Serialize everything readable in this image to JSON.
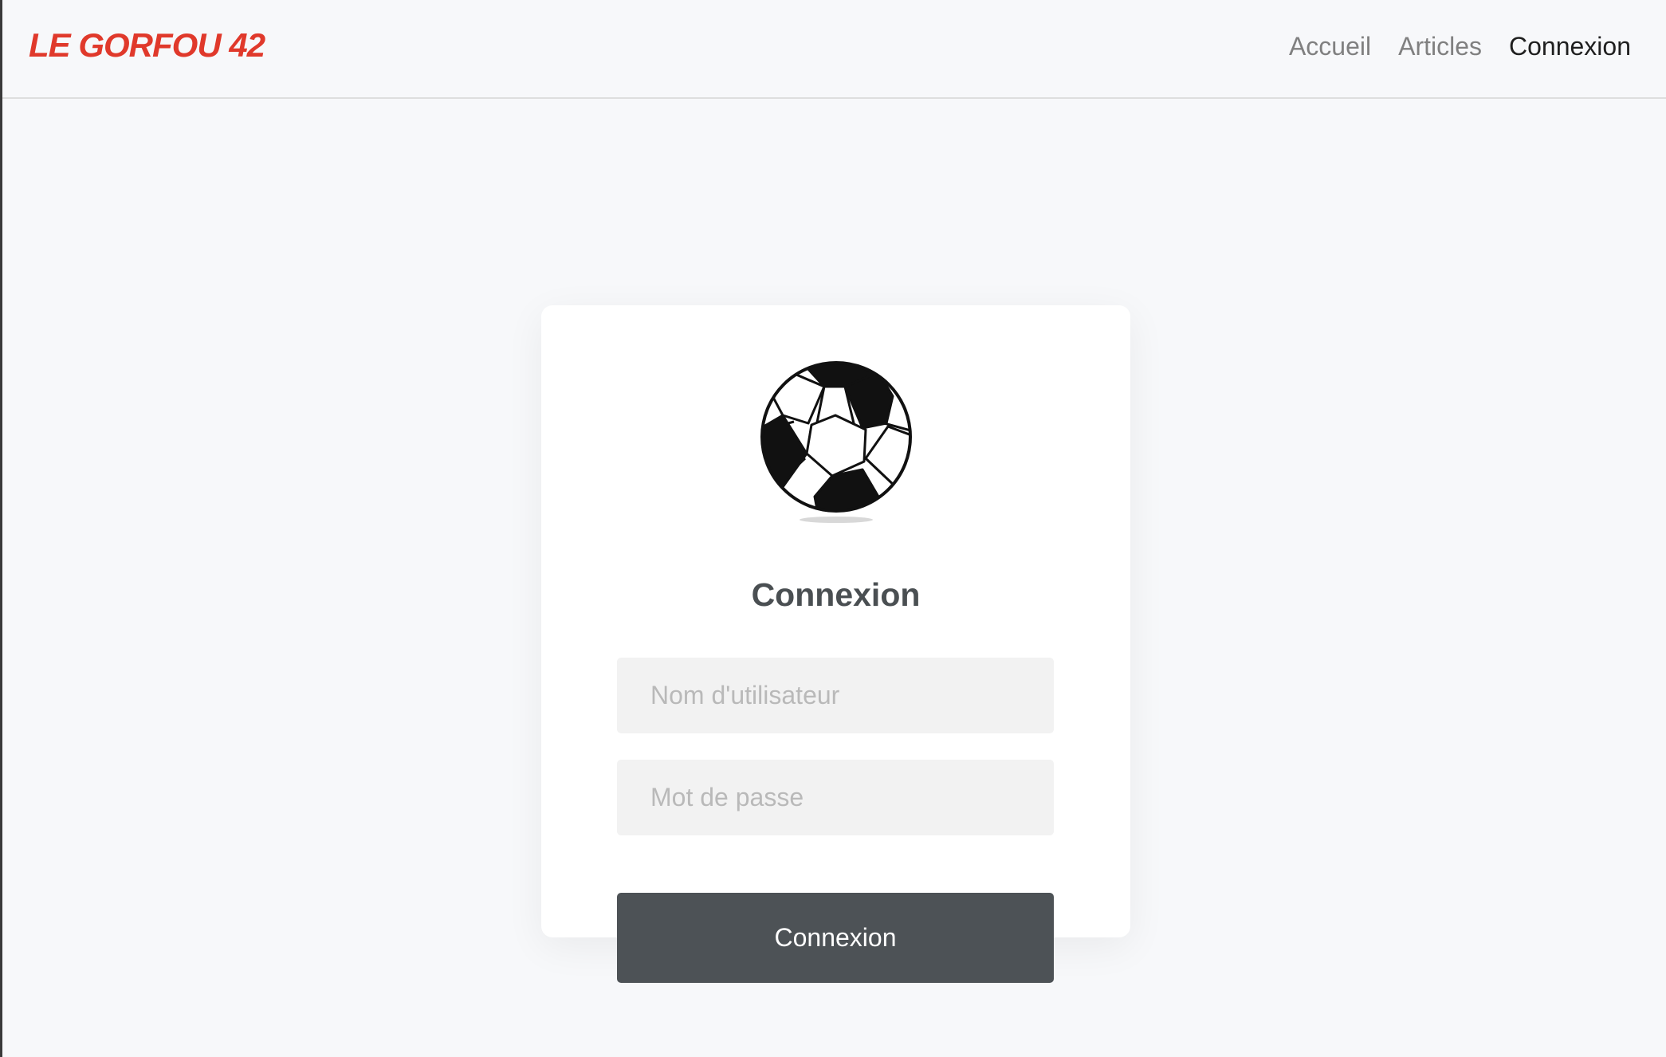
{
  "navbar": {
    "brand": "LE GORFOU 42",
    "links": [
      {
        "label": "Accueil",
        "active": false
      },
      {
        "label": "Articles",
        "active": false
      },
      {
        "label": "Connexion",
        "active": true
      }
    ]
  },
  "login": {
    "icon": "soccer-ball-icon",
    "title": "Connexion",
    "username_placeholder": "Nom d'utilisateur",
    "username_value": "",
    "password_placeholder": "Mot de passe",
    "password_value": "",
    "submit_label": "Connexion"
  },
  "colors": {
    "brand": "#e0392b",
    "background": "#f7f8fa",
    "card": "#ffffff",
    "input_bg": "#f2f2f2",
    "button_bg": "#4d5256",
    "button_text": "#ffffff",
    "nav_inactive": "#808080",
    "nav_active": "#1f1f1f"
  }
}
